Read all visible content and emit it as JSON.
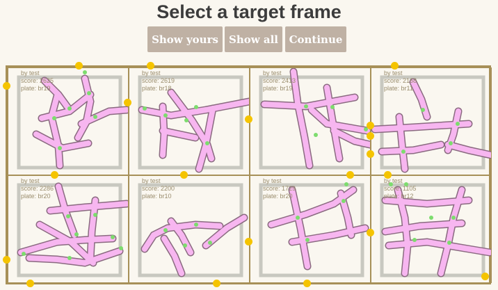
{
  "page": {
    "title": "Select a target frame",
    "buttons": {
      "yours": "Show yours",
      "all": "Show all",
      "continue": "Continue"
    }
  },
  "frames": [
    {
      "by": "by test",
      "score": "score: 2625",
      "plate": "plate: br19"
    },
    {
      "by": "by test",
      "score": "score: 2619",
      "plate": "plate: br18"
    },
    {
      "by": "by test",
      "score": "score: 2413",
      "plate": "plate: br19"
    },
    {
      "by": "by test",
      "score": "score: 2168",
      "plate": "plate: br11"
    },
    {
      "by": "by test",
      "score": "score: 2286",
      "plate": "plate: br20"
    },
    {
      "by": "by test",
      "score": "score: 2200",
      "plate": "plate: br10"
    },
    {
      "by": "by test",
      "score": "score: 1729",
      "plate": "plate: br20"
    },
    {
      "by": "by test",
      "score": "score: 1105",
      "plate": "plate: br12"
    }
  ],
  "colors": {
    "background": "#faf7f0",
    "button": "#bfb1a4",
    "frame_border": "#a79058",
    "plate_border": "#c8c8c0",
    "stroke_fill": "#f7b6f0",
    "stroke_outline": "#8a6a80",
    "node_dot": "#7ddc6e",
    "handle_dot": "#f5c400"
  }
}
